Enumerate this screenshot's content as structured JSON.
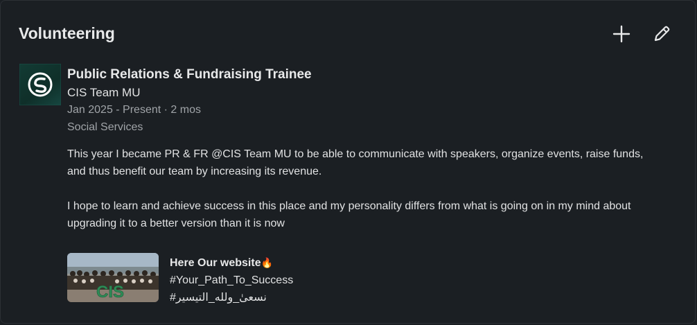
{
  "section": {
    "title": "Volunteering",
    "add_icon": "plus-icon",
    "edit_icon": "pencil-icon"
  },
  "entry": {
    "role": "Public Relations & Fundraising Trainee",
    "organization": "CIS Team MU",
    "dates": "Jan 2025 - Present · 2 mos",
    "cause": "Social Services",
    "description": [
      "This year I became PR & FR @CIS Team MU to be able to communicate with speakers, organize events, raise funds, and thus benefit our team by increasing its revenue.",
      "I hope to learn and achieve success in this place and my personality differs from what is going on in my mind about upgrading it to a better version than it is now"
    ],
    "media": {
      "title": "Here Our website",
      "emoji": "🔥",
      "line1": "#Your_Path_To_Success",
      "line2": "#نسعىٰ_ولله_التيسير",
      "thumb_text": "CIS"
    }
  },
  "colors": {
    "background": "#1b1f23",
    "text_primary": "#e8e9ea",
    "text_secondary": "#a0a4a8",
    "logo_bg": "#123b34",
    "accent_green": "#2e8b57"
  }
}
